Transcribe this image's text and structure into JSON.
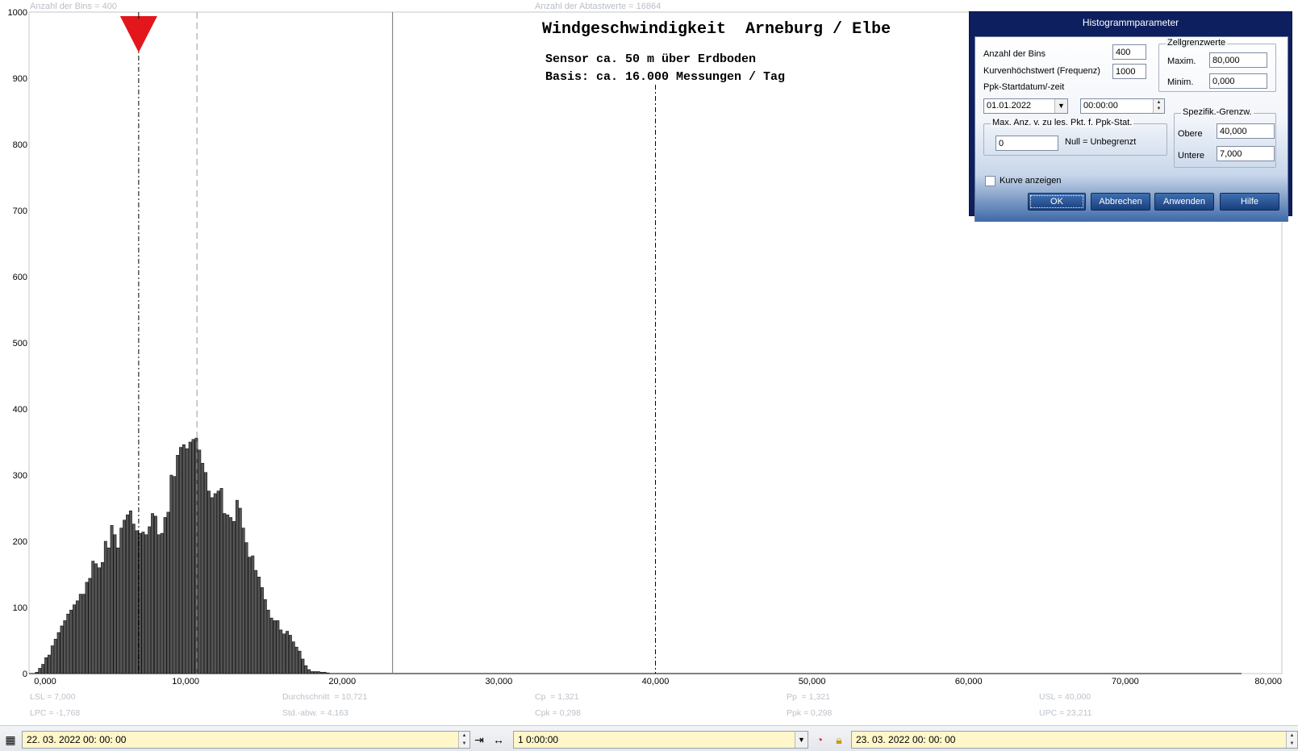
{
  "top": {
    "bins_label": "Anzahl der Bins =   400",
    "samples_label": "Anzahl der Abtastwerte = 16864"
  },
  "chart": {
    "title": "Windgeschwindigkeit  Arneburg / Elbe",
    "subtitle1": "Sensor ca. 50 m über Erdboden",
    "subtitle2": "Basis: ca. 16.000 Messungen / Tag"
  },
  "stats": {
    "lsl": "LSL = 7,000",
    "lpc": "LPC = -1,768",
    "mean": "Durchschnitt  = 10,721",
    "std": "Std.-abw. = 4,163",
    "cp": "Cp  = 1,321",
    "cpk": "Cpk = 0,298",
    "pp": "Pp  = 1,321",
    "ppk": "Ppk = 0,298",
    "usl": "USL = 40,000",
    "upc": "UPC = 23,211"
  },
  "chart_data": {
    "type": "bar",
    "title": "Windgeschwindigkeit  Arneburg / Elbe",
    "xlim": [
      0,
      80
    ],
    "ylim": [
      0,
      1000
    ],
    "x_ticks": [
      "0,000",
      "10,000",
      "20,000",
      "30,000",
      "40,000",
      "50,000",
      "60,000",
      "70,000",
      "80,000"
    ],
    "y_ticks": [
      "0",
      "100",
      "200",
      "300",
      "400",
      "500",
      "600",
      "700",
      "800",
      "900",
      "1000"
    ],
    "bin_width": 0.2,
    "bin_start": 0.4,
    "values": [
      2,
      8,
      14,
      24,
      28,
      42,
      52,
      62,
      72,
      80,
      90,
      96,
      104,
      110,
      120,
      120,
      138,
      144,
      170,
      166,
      160,
      168,
      200,
      190,
      224,
      210,
      190,
      220,
      232,
      240,
      246,
      226,
      216,
      212,
      214,
      210,
      222,
      242,
      238,
      210,
      212,
      236,
      244,
      300,
      298,
      330,
      342,
      346,
      340,
      350,
      354,
      356,
      338,
      318,
      304,
      276,
      266,
      272,
      276,
      280,
      242,
      240,
      236,
      230,
      262,
      250,
      220,
      198,
      176,
      178,
      156,
      146,
      130,
      112,
      96,
      84,
      80,
      80,
      66,
      60,
      64,
      58,
      48,
      40,
      34,
      22,
      12,
      6,
      3,
      3,
      3,
      2,
      2,
      1
    ],
    "markers": {
      "lsl": 7.0,
      "mean": 10.721,
      "usl": 40.0,
      "upc": 23.211
    }
  },
  "dialog": {
    "title": "Histogrammparameter",
    "bins_label": "Anzahl der Bins",
    "bins_value": "400",
    "curve_max_label": "Kurvenhöchstwert (Frequenz)",
    "curve_max_value": "1000",
    "ppk_start_label": "Ppk-Startdatum/-zeit",
    "date_value": "01.01.2022",
    "time_value": "00:00:00",
    "cell_group": "Zellgrenzwerte",
    "max_label": "Maxim.",
    "max_value": "80,000",
    "min_label": "Minim.",
    "min_value": "0,000",
    "max_points_group": "Max. Anz. v. zu les. Pkt. f. Ppk-Stat.",
    "max_points_value": "0",
    "null_hint": "Null = Unbegrenzt",
    "spec_group": "Spezifik.-Grenzw.",
    "upper_label": "Obere",
    "upper_value": "40,000",
    "lower_label": "Untere",
    "lower_value": "7,000",
    "curve_checkbox_label": "Kurve anzeigen",
    "ok": "OK",
    "cancel": "Abbrechen",
    "apply": "Anwenden",
    "help": "Hilfe"
  },
  "bottom": {
    "start": "22. 03. 2022   00: 00: 00",
    "interval": "1 0:00:00",
    "end": "23. 03. 2022   00: 00: 00"
  }
}
